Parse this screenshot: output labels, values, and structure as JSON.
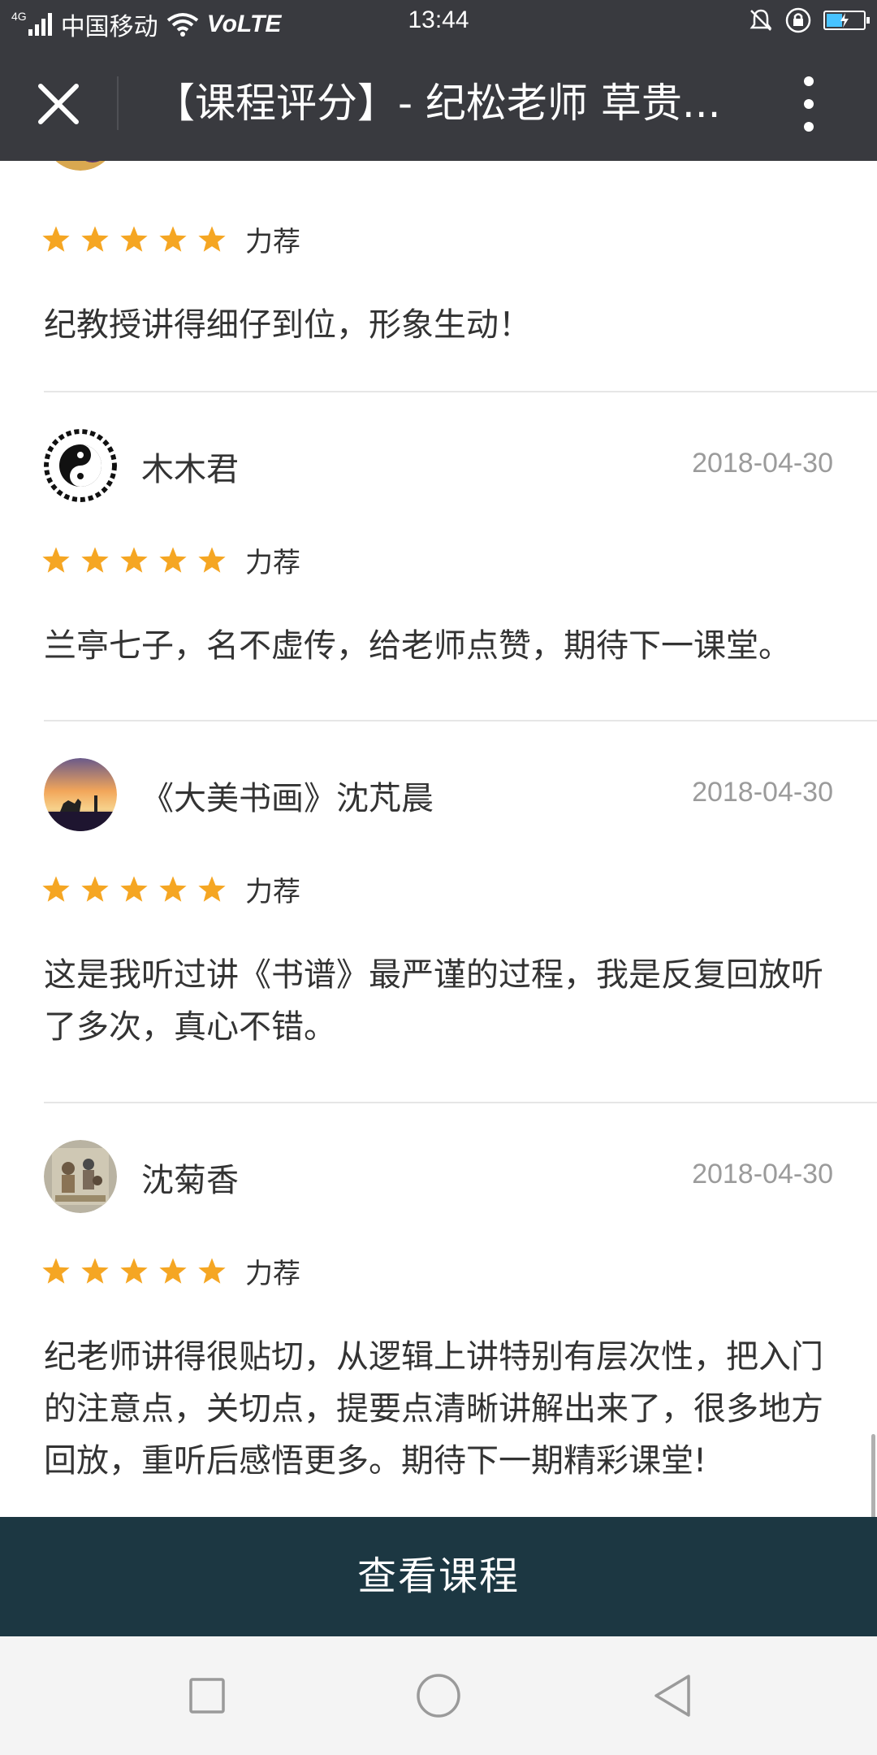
{
  "status_bar": {
    "network_type": "4G",
    "carrier": "中国移动",
    "volte": "VoLTE",
    "time": "13:44"
  },
  "title_bar": {
    "title": "【课程评分】- 纪松老师 草贵...",
    "close_icon": "close-icon",
    "more_icon": "more-vertical-icon"
  },
  "reviews": [
    {
      "name": "",
      "date": "",
      "rating": 5,
      "rating_label": "力荐",
      "text": "纪教授讲得细仔到位，形象生动！"
    },
    {
      "name": "木木君",
      "date": "2018-04-30",
      "rating": 5,
      "rating_label": "力荐",
      "text": "兰亭七子，名不虚传，给老师点赞，期待下一课堂。"
    },
    {
      "name": "《大美书画》沈芃晨",
      "date": "2018-04-30",
      "rating": 5,
      "rating_label": "力荐",
      "text": "这是我听过讲《书谱》最严谨的过程，我是反复回放听了多次，真心不错。"
    },
    {
      "name": "沈菊香",
      "date": "2018-04-30",
      "rating": 5,
      "rating_label": "力荐",
      "text": "纪老师讲得很贴切，从逻辑上讲特别有层次性，把入门的注意点，关切点，提要点清晰讲解出来了，很多地方回放，重听后感悟更多。期待下一期精彩课堂!"
    }
  ],
  "bottom_button": {
    "label": "查看课程"
  },
  "colors": {
    "title_bar": "#393a3f",
    "star": "#f5a623",
    "button_bg": "#1c3742",
    "date_text": "#9b9b9b"
  },
  "nav_bar": {
    "icons": [
      "square-recents-icon",
      "circle-home-icon",
      "triangle-back-icon"
    ]
  }
}
